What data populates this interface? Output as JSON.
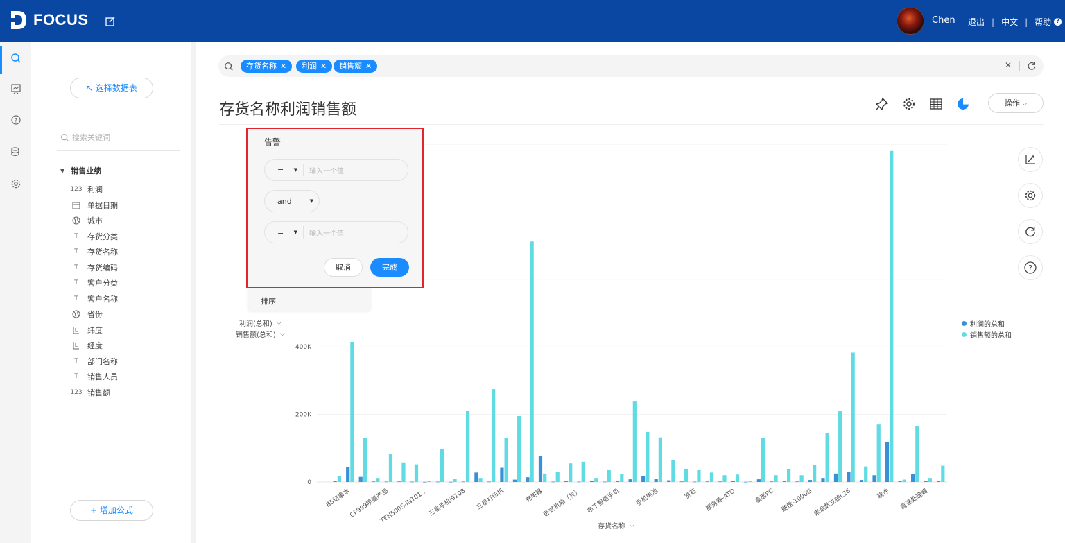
{
  "app": {
    "logo_text": "FOCUS"
  },
  "header": {
    "user_name": "Chen",
    "links": [
      "退出",
      "中文",
      "帮助"
    ],
    "help_mark": "?"
  },
  "iconbar": {
    "items": [
      "search-icon",
      "dashboard-icon",
      "help-icon",
      "database-icon",
      "settings-icon"
    ]
  },
  "sidebar": {
    "select_table_label": "↖ 选择数据表",
    "search_placeholder": "搜索关键词",
    "group_title": "销售业绩",
    "fields": [
      {
        "label": "利润",
        "type": "number"
      },
      {
        "label": "单据日期",
        "type": "date"
      },
      {
        "label": "城市",
        "type": "geo"
      },
      {
        "label": "存货分类",
        "type": "text"
      },
      {
        "label": "存货名称",
        "type": "text"
      },
      {
        "label": "存货编码",
        "type": "text"
      },
      {
        "label": "客户分类",
        "type": "text"
      },
      {
        "label": "客户名称",
        "type": "text"
      },
      {
        "label": "省份",
        "type": "geo"
      },
      {
        "label": "纬度",
        "type": "coord"
      },
      {
        "label": "经度",
        "type": "coord"
      },
      {
        "label": "部门名称",
        "type": "text"
      },
      {
        "label": "销售人员",
        "type": "text"
      },
      {
        "label": "销售额",
        "type": "number"
      }
    ],
    "add_formula_label": "+ 增加公式"
  },
  "search": {
    "chips": [
      "存货名称",
      "利润",
      "销售额"
    ]
  },
  "main": {
    "title": "存货名称利润销售额",
    "ops_label": "操作"
  },
  "alert": {
    "title": "告警",
    "op1": "=",
    "placeholder1": "输入一个值",
    "logic": "and",
    "op2": "=",
    "placeholder2": "输入一个值",
    "cancel_label": "取消",
    "done_label": "完成"
  },
  "menu_under": {
    "item": "排序"
  },
  "axis_selectors": {
    "y1": "利润(总和)",
    "y2": "销售额(总和)",
    "x": "存货名称"
  },
  "colors": {
    "brand": "#0a47a2",
    "accent": "#1a8cff",
    "series_profit": "#3a8fd6",
    "series_sales": "#5fdbe3",
    "alert_border": "#e0262c"
  },
  "chart_data": {
    "type": "bar",
    "ylim": [
      0,
      1000000
    ],
    "yticks": [
      "0",
      "200K",
      "400K"
    ],
    "categories": [
      "B5记事本",
      "CP999喷墨产品",
      "TEH500S-INT01...",
      "三星手机i9108",
      "三星打印机",
      "充电器",
      "卧式机箱（灰）",
      "布丁智能手机",
      "手机电池",
      "宽石",
      "服务器-ATO",
      "桌面PC",
      "硬盘-1000G",
      "索尼数立拍L26",
      "软件",
      "高速处理器"
    ],
    "tick_labels": [
      "B5记事本",
      "CP999喷墨产品",
      "TEH500S-INT01...",
      "三星手机i9108",
      "三星打印机",
      "充电器",
      "卧式机箱（灰）",
      "布丁智能手机",
      "手机电池",
      "宽石",
      "服务器-ATO",
      "桌面PC",
      "硬盘-1000G",
      "索尼数立拍L26",
      "软件",
      "高速处理器"
    ],
    "legend": [
      "利润的总和",
      "销售额的总和"
    ],
    "series": [
      {
        "name": "利润的总和",
        "values": [
          3000,
          44000,
          15000,
          1500,
          1200,
          1500,
          1000,
          500,
          1000,
          500,
          1200,
          28000,
          1200,
          42000,
          7000,
          14000,
          76000,
          1000,
          2000,
          1000,
          3000,
          1000,
          2000,
          8000,
          18000,
          10000,
          5000,
          1500,
          1000,
          1500,
          1500,
          4000,
          500,
          8000,
          1500,
          2000,
          1500,
          6000,
          12000,
          25000,
          30000,
          6000,
          20000,
          118000,
          2000,
          23000,
          3000,
          2000
        ]
      },
      {
        "name": "销售额的总和",
        "values": [
          18000,
          415000,
          130000,
          12000,
          83000,
          58000,
          52000,
          4000,
          98000,
          10000,
          210000,
          12000,
          275000,
          130000,
          195000,
          712000,
          25000,
          30000,
          55000,
          60000,
          12000,
          35000,
          24000,
          240000,
          148000,
          132000,
          65000,
          38000,
          35000,
          28000,
          20000,
          22000,
          4000,
          130000,
          20000,
          38000,
          20000,
          50000,
          145000,
          210000,
          383000,
          46000,
          170000,
          980000,
          7000,
          165000,
          12000,
          48000
        ]
      }
    ]
  }
}
